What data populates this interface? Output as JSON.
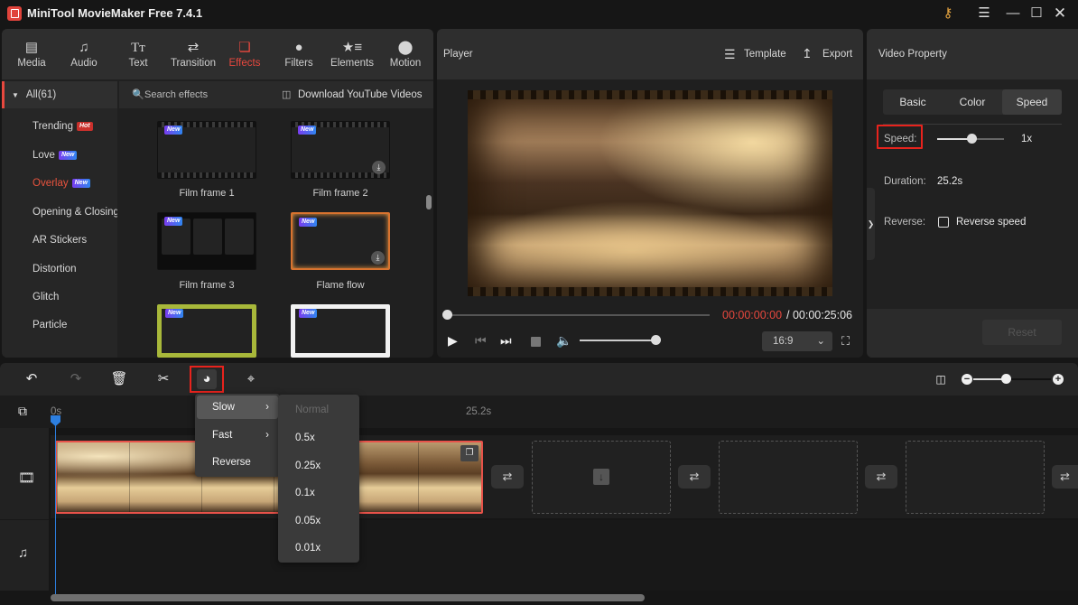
{
  "app": {
    "title": "MiniTool MovieMaker Free 7.4.1"
  },
  "window_controls": {
    "key": "key-icon",
    "menu": "menu-icon",
    "minimize": "minimize-icon",
    "maximize": "maximize-icon",
    "close": "close-icon"
  },
  "media_tabs": [
    {
      "label": "Media",
      "icon": "folder-icon"
    },
    {
      "label": "Audio",
      "icon": "music-icon"
    },
    {
      "label": "Text",
      "icon": "text-icon"
    },
    {
      "label": "Transition",
      "icon": "transition-icon"
    },
    {
      "label": "Effects",
      "icon": "effects-icon",
      "active": true
    },
    {
      "label": "Filters",
      "icon": "filters-icon"
    },
    {
      "label": "Elements",
      "icon": "elements-icon"
    },
    {
      "label": "Motion",
      "icon": "motion-icon"
    }
  ],
  "effects": {
    "all_label": "All(61)",
    "search_placeholder": "Search effects",
    "download_label": "Download YouTube Videos",
    "categories": [
      {
        "label": "Trending",
        "badge": "Hot"
      },
      {
        "label": "Love",
        "badge": "New"
      },
      {
        "label": "Overlay",
        "badge": "New",
        "selected": true
      },
      {
        "label": "Opening & Closing"
      },
      {
        "label": "AR Stickers"
      },
      {
        "label": "Distortion"
      },
      {
        "label": "Glitch"
      },
      {
        "label": "Particle"
      }
    ],
    "items": [
      {
        "label": "Film frame 1",
        "badge": "New"
      },
      {
        "label": "Film frame 2",
        "badge": "New",
        "download": true
      },
      {
        "label": "Film frame 3",
        "badge": "New"
      },
      {
        "label": "Flame flow",
        "badge": "New",
        "download": true
      },
      {
        "label": "",
        "badge": "New"
      },
      {
        "label": "",
        "badge": "New",
        "download": true
      }
    ]
  },
  "player": {
    "title": "Player",
    "template_label": "Template",
    "export_label": "Export",
    "current_time": "00:00:00:00",
    "total_time": "/ 00:00:25:06",
    "aspect_ratio": "16:9",
    "seek_progress": 0,
    "volume": 1.0
  },
  "property": {
    "title": "Video Property",
    "tabs": [
      "Basic",
      "Color",
      "Speed"
    ],
    "active_tab": "Speed",
    "speed_label": "Speed:",
    "speed_value": "1x",
    "duration_label": "Duration:",
    "duration_value": "25.2s",
    "reverse_label": "Reverse:",
    "reverse_checkbox_label": "Reverse speed",
    "reverse_checked": false,
    "reset_label": "Reset"
  },
  "timeline": {
    "ruler_start": "0s",
    "ruler_mark": "25.2s",
    "zoom_level": 0.45
  },
  "speed_menu": {
    "items": [
      {
        "label": "Slow",
        "submenu": true,
        "highlighted": true
      },
      {
        "label": "Fast",
        "submenu": true
      },
      {
        "label": "Reverse"
      }
    ],
    "slow_options": [
      {
        "label": "Normal",
        "disabled": true
      },
      {
        "label": "0.5x"
      },
      {
        "label": "0.25x"
      },
      {
        "label": "0.1x"
      },
      {
        "label": "0.05x"
      },
      {
        "label": "0.01x"
      }
    ]
  },
  "colors": {
    "accent": "#e8483e",
    "highlight_box": "#e8231d",
    "playhead": "#2d7fe0"
  }
}
